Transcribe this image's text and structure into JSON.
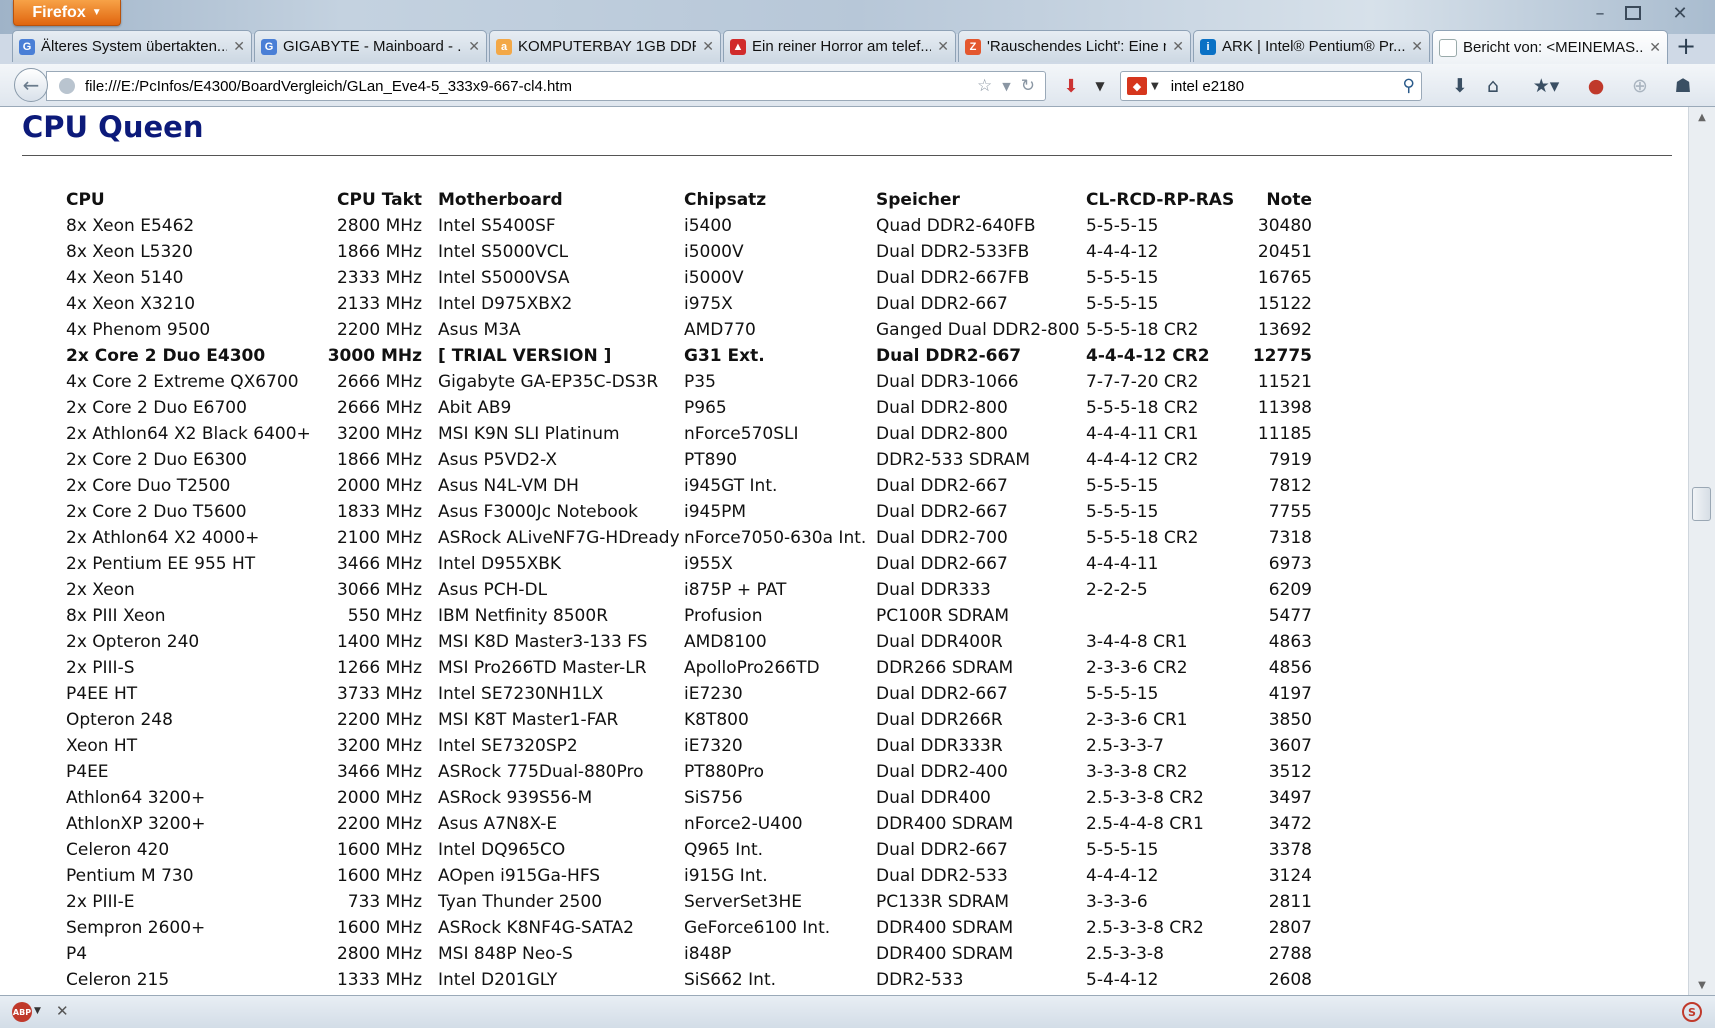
{
  "browser": {
    "menu_label": "Firefox",
    "tabs": [
      {
        "label": "Älteres System übertakten...",
        "icon": "google-icon",
        "active": false
      },
      {
        "label": "GIGABYTE - Mainboard - ...",
        "icon": "google-icon",
        "active": false
      },
      {
        "label": "KOMPUTERBAY 1GB DDR ...",
        "icon": "amazon-icon",
        "active": false
      },
      {
        "label": "Ein reiner Horror am telef...",
        "icon": "red-flag-icon",
        "active": false
      },
      {
        "label": "'Rauschendes Licht': Eine n...",
        "icon": "zdf-icon",
        "active": false
      },
      {
        "label": "ARK | Intel® Pentium® Pr...",
        "icon": "intel-icon",
        "active": false
      },
      {
        "label": "Bericht von: <MEINEMAS...",
        "icon": "blank-page-icon",
        "active": true
      }
    ],
    "url": "file:///E:/PcInfos/E4300/BoardVergleich/GLan_Eve4-5_333x9-667-cl4.htm",
    "search_query": "intel e2180"
  },
  "page": {
    "title": "CPU Queen",
    "table": {
      "headers": {
        "cpu": "CPU",
        "takt": "CPU Takt",
        "board": "Motherboard",
        "chip": "Chipsatz",
        "mem": "Speicher",
        "cl": "CL-RCD-RP-RAS",
        "note": "Note"
      },
      "rows": [
        {
          "cpu": "8x Xeon E5462",
          "takt": "2800 MHz",
          "board": "Intel S5400SF",
          "chip": "i5400",
          "mem": "Quad DDR2-640FB",
          "cl": "5-5-5-15",
          "note": "30480",
          "highlight": false
        },
        {
          "cpu": "8x Xeon L5320",
          "takt": "1866 MHz",
          "board": "Intel S5000VCL",
          "chip": "i5000V",
          "mem": "Dual DDR2-533FB",
          "cl": "4-4-4-12",
          "note": "20451",
          "highlight": false
        },
        {
          "cpu": "4x Xeon 5140",
          "takt": "2333 MHz",
          "board": "Intel S5000VSA",
          "chip": "i5000V",
          "mem": "Dual DDR2-667FB",
          "cl": "5-5-5-15",
          "note": "16765",
          "highlight": false
        },
        {
          "cpu": "4x Xeon X3210",
          "takt": "2133 MHz",
          "board": "Intel D975XBX2",
          "chip": "i975X",
          "mem": "Dual DDR2-667",
          "cl": "5-5-5-15",
          "note": "15122",
          "highlight": false
        },
        {
          "cpu": "4x Phenom 9500",
          "takt": "2200 MHz",
          "board": "Asus M3A",
          "chip": "AMD770",
          "mem": "Ganged Dual DDR2-800",
          "cl": "5-5-5-18 CR2",
          "note": "13692",
          "highlight": false
        },
        {
          "cpu": "2x Core 2 Duo E4300",
          "takt": "3000 MHz",
          "board": "[ TRIAL VERSION ]",
          "chip": "G31 Ext.",
          "mem": "Dual DDR2-667",
          "cl": "4-4-4-12 CR2",
          "note": "12775",
          "highlight": true
        },
        {
          "cpu": "4x Core 2 Extreme QX6700",
          "takt": "2666 MHz",
          "board": "Gigabyte GA-EP35C-DS3R",
          "chip": "P35",
          "mem": "Dual DDR3-1066",
          "cl": "7-7-7-20 CR2",
          "note": "11521",
          "highlight": false
        },
        {
          "cpu": "2x Core 2 Duo E6700",
          "takt": "2666 MHz",
          "board": "Abit AB9",
          "chip": "P965",
          "mem": "Dual DDR2-800",
          "cl": "5-5-5-18 CR2",
          "note": "11398",
          "highlight": false
        },
        {
          "cpu": "2x Athlon64 X2 Black 6400+",
          "takt": "3200 MHz",
          "board": "MSI K9N SLI Platinum",
          "chip": "nForce570SLI",
          "mem": "Dual DDR2-800",
          "cl": "4-4-4-11 CR1",
          "note": "11185",
          "highlight": false
        },
        {
          "cpu": "2x Core 2 Duo E6300",
          "takt": "1866 MHz",
          "board": "Asus P5VD2-X",
          "chip": "PT890",
          "mem": "DDR2-533 SDRAM",
          "cl": "4-4-4-12 CR2",
          "note": "7919",
          "highlight": false
        },
        {
          "cpu": "2x Core Duo T2500",
          "takt": "2000 MHz",
          "board": "Asus N4L-VM DH",
          "chip": "i945GT Int.",
          "mem": "Dual DDR2-667",
          "cl": "5-5-5-15",
          "note": "7812",
          "highlight": false
        },
        {
          "cpu": "2x Core 2 Duo T5600",
          "takt": "1833 MHz",
          "board": "Asus F3000Jc Notebook",
          "chip": "i945PM",
          "mem": "Dual DDR2-667",
          "cl": "5-5-5-15",
          "note": "7755",
          "highlight": false
        },
        {
          "cpu": "2x Athlon64 X2 4000+",
          "takt": "2100 MHz",
          "board": "ASRock ALiveNF7G-HDready",
          "chip": "nForce7050-630a Int.",
          "mem": "Dual DDR2-700",
          "cl": "5-5-5-18 CR2",
          "note": "7318",
          "highlight": false
        },
        {
          "cpu": "2x Pentium EE 955 HT",
          "takt": "3466 MHz",
          "board": "Intel D955XBK",
          "chip": "i955X",
          "mem": "Dual DDR2-667",
          "cl": "4-4-4-11",
          "note": "6973",
          "highlight": false
        },
        {
          "cpu": "2x Xeon",
          "takt": "3066 MHz",
          "board": "Asus PCH-DL",
          "chip": "i875P + PAT",
          "mem": "Dual DDR333",
          "cl": "2-2-2-5",
          "note": "6209",
          "highlight": false
        },
        {
          "cpu": "8x PIII Xeon",
          "takt": "550 MHz",
          "board": "IBM Netfinity 8500R",
          "chip": "Profusion",
          "mem": "PC100R SDRAM",
          "cl": "",
          "note": "5477",
          "highlight": false
        },
        {
          "cpu": "2x Opteron 240",
          "takt": "1400 MHz",
          "board": "MSI K8D Master3-133 FS",
          "chip": "AMD8100",
          "mem": "Dual DDR400R",
          "cl": "3-4-4-8 CR1",
          "note": "4863",
          "highlight": false
        },
        {
          "cpu": "2x PIII-S",
          "takt": "1266 MHz",
          "board": "MSI Pro266TD Master-LR",
          "chip": "ApolloPro266TD",
          "mem": "DDR266 SDRAM",
          "cl": "2-3-3-6 CR2",
          "note": "4856",
          "highlight": false
        },
        {
          "cpu": "P4EE HT",
          "takt": "3733 MHz",
          "board": "Intel SE7230NH1LX",
          "chip": "iE7230",
          "mem": "Dual DDR2-667",
          "cl": "5-5-5-15",
          "note": "4197",
          "highlight": false
        },
        {
          "cpu": "Opteron 248",
          "takt": "2200 MHz",
          "board": "MSI K8T Master1-FAR",
          "chip": "K8T800",
          "mem": "Dual DDR266R",
          "cl": "2-3-3-6 CR1",
          "note": "3850",
          "highlight": false
        },
        {
          "cpu": "Xeon HT",
          "takt": "3200 MHz",
          "board": "Intel SE7320SP2",
          "chip": "iE7320",
          "mem": "Dual DDR333R",
          "cl": "2.5-3-3-7",
          "note": "3607",
          "highlight": false
        },
        {
          "cpu": "P4EE",
          "takt": "3466 MHz",
          "board": "ASRock 775Dual-880Pro",
          "chip": "PT880Pro",
          "mem": "Dual DDR2-400",
          "cl": "3-3-3-8 CR2",
          "note": "3512",
          "highlight": false
        },
        {
          "cpu": "Athlon64 3200+",
          "takt": "2000 MHz",
          "board": "ASRock 939S56-M",
          "chip": "SiS756",
          "mem": "Dual DDR400",
          "cl": "2.5-3-3-8 CR2",
          "note": "3497",
          "highlight": false
        },
        {
          "cpu": "AthlonXP 3200+",
          "takt": "2200 MHz",
          "board": "Asus A7N8X-E",
          "chip": "nForce2-U400",
          "mem": "DDR400 SDRAM",
          "cl": "2.5-4-4-8 CR1",
          "note": "3472",
          "highlight": false
        },
        {
          "cpu": "Celeron 420",
          "takt": "1600 MHz",
          "board": "Intel DQ965CO",
          "chip": "Q965 Int.",
          "mem": "Dual DDR2-667",
          "cl": "5-5-5-15",
          "note": "3378",
          "highlight": false
        },
        {
          "cpu": "Pentium M 730",
          "takt": "1600 MHz",
          "board": "AOpen i915Ga-HFS",
          "chip": "i915G Int.",
          "mem": "Dual DDR2-533",
          "cl": "4-4-4-12",
          "note": "3124",
          "highlight": false
        },
        {
          "cpu": "2x PIII-E",
          "takt": "733 MHz",
          "board": "Tyan Thunder 2500",
          "chip": "ServerSet3HE",
          "mem": "PC133R SDRAM",
          "cl": "3-3-3-6",
          "note": "2811",
          "highlight": false
        },
        {
          "cpu": "Sempron 2600+",
          "takt": "1600 MHz",
          "board": "ASRock K8NF4G-SATA2",
          "chip": "GeForce6100 Int.",
          "mem": "DDR400 SDRAM",
          "cl": "2.5-3-3-8 CR2",
          "note": "2807",
          "highlight": false
        },
        {
          "cpu": "P4",
          "takt": "2800 MHz",
          "board": "MSI 848P Neo-S",
          "chip": "i848P",
          "mem": "DDR400 SDRAM",
          "cl": "2.5-3-3-8",
          "note": "2788",
          "highlight": false
        },
        {
          "cpu": "Celeron 215",
          "takt": "1333 MHz",
          "board": "Intel D201GLY",
          "chip": "SiS662 Int.",
          "mem": "DDR2-533",
          "cl": "5-4-4-12",
          "note": "2608",
          "highlight": false
        }
      ]
    }
  }
}
